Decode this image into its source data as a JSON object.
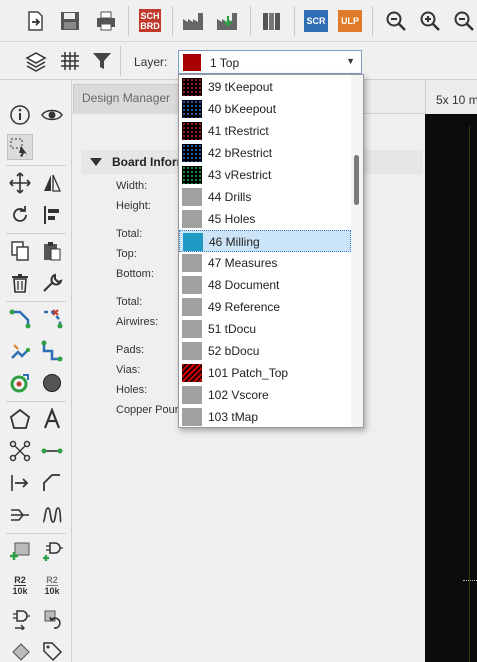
{
  "toolbar": {
    "sch_brd": [
      "SCH",
      "BRD"
    ],
    "scr": "SCR",
    "ulp": "ULP"
  },
  "layer_bar": {
    "label": "Layer:",
    "selected": {
      "number": "1",
      "name": "1 Top",
      "color": "#a80000"
    }
  },
  "tabs": {
    "design_manager": "Design Manager",
    "board_tab": "5x 10 m"
  },
  "board_info": {
    "title": "Board Inform",
    "labels": [
      "Width:",
      "Height:",
      "Total:",
      "Top:",
      "Bottom:",
      "Total:",
      "Airwires:",
      "Pads:",
      "Vias:",
      "Holes:",
      "Copper Pours"
    ]
  },
  "left_tools": {
    "r2_10k_a": [
      "R2",
      "10k"
    ],
    "r2_10k_b": [
      "R2",
      "10k"
    ]
  },
  "layer_dropdown": {
    "selected_index": 7,
    "items": [
      {
        "label": "39 tKeepout",
        "color": "#000000",
        "pattern": "dots-red"
      },
      {
        "label": "40 bKeepout",
        "color": "#000000",
        "pattern": "dots-blue"
      },
      {
        "label": "41 tRestrict",
        "color": "#000000",
        "pattern": "dots-red"
      },
      {
        "label": "42 bRestrict",
        "color": "#000000",
        "pattern": "dots-blue"
      },
      {
        "label": "43 vRestrict",
        "color": "#000000",
        "pattern": "dots-green"
      },
      {
        "label": "44 Drills",
        "color": "#a0a0a0",
        "pattern": "solid"
      },
      {
        "label": "45 Holes",
        "color": "#a0a0a0",
        "pattern": "solid"
      },
      {
        "label": "46 Milling",
        "color": "#1e9bc4",
        "pattern": "solid"
      },
      {
        "label": "47 Measures",
        "color": "#a0a0a0",
        "pattern": "solid"
      },
      {
        "label": "48 Document",
        "color": "#a0a0a0",
        "pattern": "solid"
      },
      {
        "label": "49 Reference",
        "color": "#a0a0a0",
        "pattern": "solid"
      },
      {
        "label": "51 tDocu",
        "color": "#a0a0a0",
        "pattern": "solid"
      },
      {
        "label": "52 bDocu",
        "color": "#a0a0a0",
        "pattern": "solid"
      },
      {
        "label": "101 Patch_Top",
        "color": "#cc0000",
        "pattern": "hatch-red"
      },
      {
        "label": "102 Vscore",
        "color": "#a0a0a0",
        "pattern": "solid"
      },
      {
        "label": "103 tMap",
        "color": "#a0a0a0",
        "pattern": "solid"
      }
    ]
  }
}
